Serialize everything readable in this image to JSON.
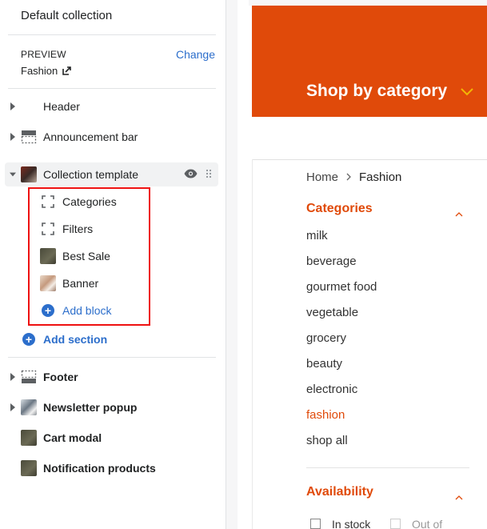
{
  "sidebar": {
    "title": "Default collection",
    "preview_label": "PREVIEW",
    "preview_value": "Fashion",
    "change_label": "Change",
    "sections": [
      {
        "label": "Header"
      },
      {
        "label": "Announcement bar"
      },
      {
        "label": "Collection template"
      },
      {
        "label": "Footer"
      },
      {
        "label": "Newsletter popup"
      },
      {
        "label": "Cart modal"
      },
      {
        "label": "Notification products"
      }
    ],
    "blocks": [
      {
        "label": "Categories",
        "icon": "dashed-square-icon"
      },
      {
        "label": "Filters",
        "icon": "dashed-square-icon"
      },
      {
        "label": "Best Sale",
        "icon": "image-thumbnail"
      },
      {
        "label": "Banner",
        "icon": "image-thumbnail"
      }
    ],
    "add_block_label": "Add block",
    "add_section_label": "Add section"
  },
  "preview": {
    "banner_title": "Shop by category",
    "breadcrumb": {
      "home": "Home",
      "current": "Fashion"
    },
    "categories_title": "Categories",
    "categories": [
      "milk",
      "beverage",
      "gourmet food",
      "vegetable",
      "grocery",
      "beauty",
      "electronic",
      "fashion",
      "shop all"
    ],
    "active_category": "fashion",
    "availability_title": "Availability",
    "availability_options": [
      "In stock",
      "Out of"
    ]
  },
  "colors": {
    "accent": "#e04a0a",
    "link": "#2c6ecb",
    "highlight_box": "#ee1111",
    "chevron_yellow": "#f2b705"
  }
}
